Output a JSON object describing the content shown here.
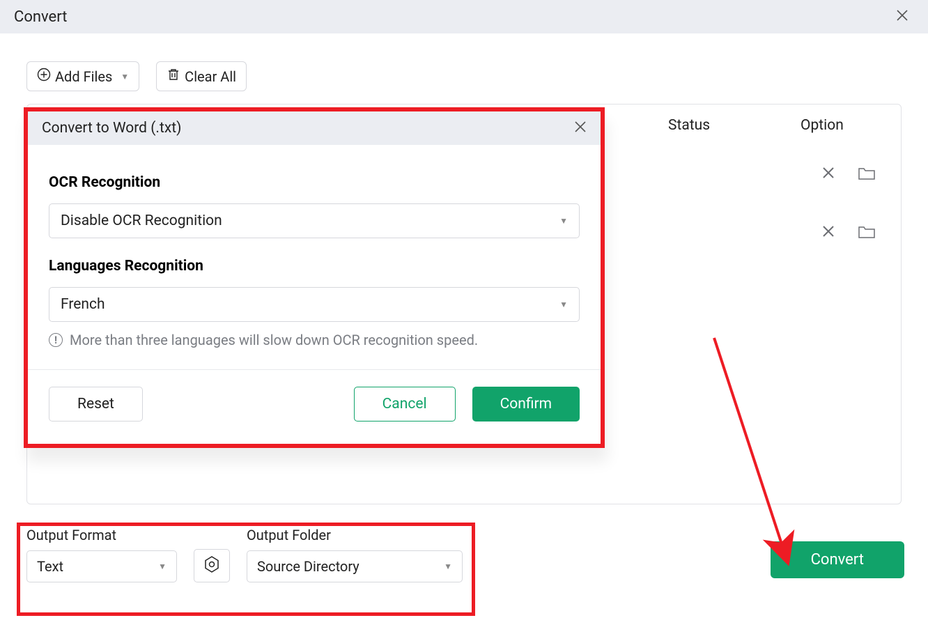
{
  "window": {
    "title": "Convert"
  },
  "toolbar": {
    "add_files_label": "Add Files",
    "clear_all_label": "Clear All"
  },
  "table": {
    "columns": {
      "status": "Status",
      "option": "Option"
    }
  },
  "modal": {
    "title": "Convert to Word (.txt)",
    "ocr_section_label": "OCR Recognition",
    "ocr_value": "Disable OCR Recognition",
    "lang_section_label": "Languages Recognition",
    "lang_value": "French",
    "info_text": "More than three languages will slow down OCR recognition speed.",
    "reset_label": "Reset",
    "cancel_label": "Cancel",
    "confirm_label": "Confirm"
  },
  "output": {
    "format_label": "Output Format",
    "format_value": "Text",
    "folder_label": "Output Folder",
    "folder_value": "Source Directory"
  },
  "actions": {
    "convert_label": "Convert"
  }
}
